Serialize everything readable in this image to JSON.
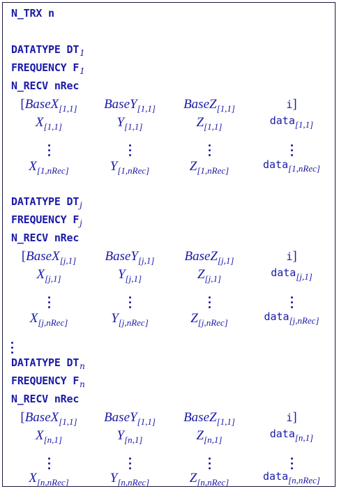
{
  "header": {
    "kw": "N_TRX",
    "val": "n"
  },
  "blocks": [
    {
      "datatype_kw": "DATATYPE",
      "datatype_val": "DT",
      "datatype_sub": "1",
      "frequency_kw": "FREQUENCY",
      "frequency_val": "F",
      "frequency_sub": "1",
      "nrecv_kw": "N_RECV",
      "nrecv_val": "nRec",
      "base_row": {
        "bx": "BaseX",
        "bx_sub": "[1,1]",
        "by": "BaseY",
        "by_sub": "[1,1]",
        "bz": "BaseZ",
        "bz_sub": "[1,1]",
        "i": "i"
      },
      "first_row": {
        "x": "X",
        "x_sub": "[1,1]",
        "y": "Y",
        "y_sub": "[1,1]",
        "z": "Z",
        "z_sub": "[1,1]",
        "d": "data",
        "d_sub": "[1,1]"
      },
      "last_row": {
        "x": "X",
        "x_sub": "[1,nRec]",
        "y": "Y",
        "y_sub": "[1,nRec]",
        "z": "Z",
        "z_sub": "[1,nRec]",
        "d": "data",
        "d_sub": "[1,nRec]"
      }
    },
    {
      "datatype_kw": "DATATYPE",
      "datatype_val": "DT",
      "datatype_sub": "j",
      "frequency_kw": "FREQUENCY",
      "frequency_val": "F",
      "frequency_sub": "j",
      "nrecv_kw": "N_RECV",
      "nrecv_val": "nRec",
      "base_row": {
        "bx": "BaseX",
        "bx_sub": "[j,1]",
        "by": "BaseY",
        "by_sub": "[j,1]",
        "bz": "BaseZ",
        "bz_sub": "[j,1]",
        "i": "i"
      },
      "first_row": {
        "x": "X",
        "x_sub": "[j,1]",
        "y": "Y",
        "y_sub": "[j,1]",
        "z": "Z",
        "z_sub": "[j,1]",
        "d": "data",
        "d_sub": "[j,1]"
      },
      "last_row": {
        "x": "X",
        "x_sub": "[j,nRec]",
        "y": "Y",
        "y_sub": "[j,nRec]",
        "z": "Z",
        "z_sub": "[j,nRec]",
        "d": "data",
        "d_sub": "[j,nRec]"
      }
    },
    {
      "datatype_kw": "DATATYPE",
      "datatype_val": "DT",
      "datatype_sub": "n",
      "frequency_kw": "FREQUENCY",
      "frequency_val": "F",
      "frequency_sub": "n",
      "nrecv_kw": "N_RECV",
      "nrecv_val": "nRec",
      "base_row": {
        "bx": "BaseX",
        "bx_sub": "[1,1]",
        "by": "BaseY",
        "by_sub": "[1,1]",
        "bz": "BaseZ",
        "bz_sub": "[1,1]",
        "i": "i"
      },
      "first_row": {
        "x": "X",
        "x_sub": "[n,1]",
        "y": "Y",
        "y_sub": "[n,1]",
        "z": "Z",
        "z_sub": "[n,1]",
        "d": "data",
        "d_sub": "[n,1]"
      },
      "last_row": {
        "x": "X",
        "x_sub": "[n,nRec]",
        "y": "Y",
        "y_sub": "[n,nRec]",
        "z": "Z",
        "z_sub": "[n,nRec]",
        "d": "data",
        "d_sub": "[n,nRec]"
      }
    }
  ],
  "colors": {
    "text": "#1a1aa6",
    "border": "#1a1a40"
  }
}
